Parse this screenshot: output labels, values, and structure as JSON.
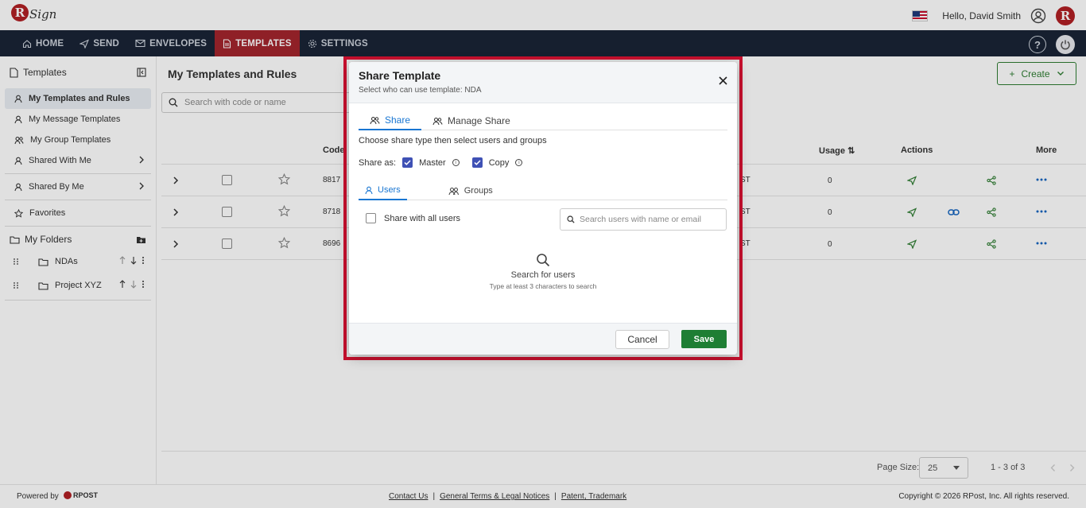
{
  "topbar": {
    "logo_letter": "R",
    "logo_text": "Sign",
    "greeting": "Hello, David Smith",
    "brand_letter": "R"
  },
  "nav": {
    "items": [
      {
        "label": "HOME",
        "icon": "home-icon"
      },
      {
        "label": "SEND",
        "icon": "send-icon"
      },
      {
        "label": "ENVELOPES",
        "icon": "envelope-icon"
      },
      {
        "label": "TEMPLATES",
        "icon": "template-icon",
        "active": true
      },
      {
        "label": "SETTINGS",
        "icon": "gear-icon"
      }
    ],
    "help": "?"
  },
  "sidebar": {
    "header": "Templates",
    "items": [
      {
        "label": "My Templates and Rules",
        "active": true
      },
      {
        "label": "My Message Templates"
      },
      {
        "label": "My Group Templates"
      },
      {
        "label": "Shared With Me"
      },
      {
        "label": "Shared By Me"
      },
      {
        "label": "Favorites"
      }
    ],
    "folders_header": "My Folders",
    "folders": [
      {
        "label": "NDAs"
      },
      {
        "label": "Project XYZ"
      }
    ]
  },
  "main": {
    "title": "My Templates and Rules",
    "search_placeholder": "Search with code or name",
    "create_label": "Create",
    "columns": {
      "code": "Code",
      "usage": "Usage",
      "actions": "Actions",
      "more": "More"
    },
    "rows": [
      {
        "code": "8817",
        "tail": "ST",
        "usage": "0"
      },
      {
        "code": "8718",
        "tail": "ST",
        "usage": "0"
      },
      {
        "code": "8696",
        "tail": "ST",
        "usage": "0"
      }
    ],
    "page_size_label": "Page Size:",
    "page_size": "25",
    "range": "1 - 3 of 3"
  },
  "footer": {
    "powered_by": "Powered by",
    "rpost": "RPOST",
    "links": [
      "Contact Us",
      "General Terms & Legal Notices",
      "Patent, Trademark"
    ],
    "copyright": "Copyright © 2026 RPost, Inc. All rights reserved."
  },
  "modal": {
    "title": "Share Template",
    "subtitle": "Select who can use template:  NDA",
    "tabs": [
      "Share",
      "Manage Share"
    ],
    "instruction": "Choose share type then select users and groups",
    "share_as_label": "Share as:",
    "master_label": "Master",
    "copy_label": "Copy",
    "subtabs": [
      "Users",
      "Groups"
    ],
    "share_all_label": "Share with all users",
    "user_search_placeholder": "Search users with name or email",
    "empty_title": "Search for users",
    "empty_hint": "Type at least 3 characters to search",
    "cancel_label": "Cancel",
    "save_label": "Save"
  },
  "colors": {
    "nav_bg": "#1a2436",
    "active_tab": "#a3252d",
    "accent": "#1976d2",
    "save": "#1e7e34",
    "highlight": "#c8102e"
  }
}
